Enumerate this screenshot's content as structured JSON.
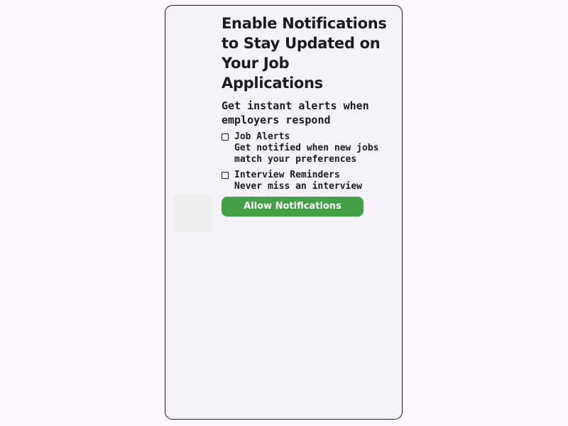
{
  "screen": {
    "title": "Enable Notifications to Stay Updated on Your Job Applications",
    "subtitle": "Get instant alerts when employers respond",
    "options": [
      {
        "title": "Job Alerts",
        "description": "Get notified when new jobs match your preferences"
      },
      {
        "title": "Interview Reminders",
        "description": "Never miss an interview"
      }
    ],
    "cta_label": "Allow Notifications"
  },
  "colors": {
    "background": "#fcf8fe",
    "surface": "#f5f3f7",
    "text": "#1c1b1f",
    "accent": "#43a047"
  }
}
